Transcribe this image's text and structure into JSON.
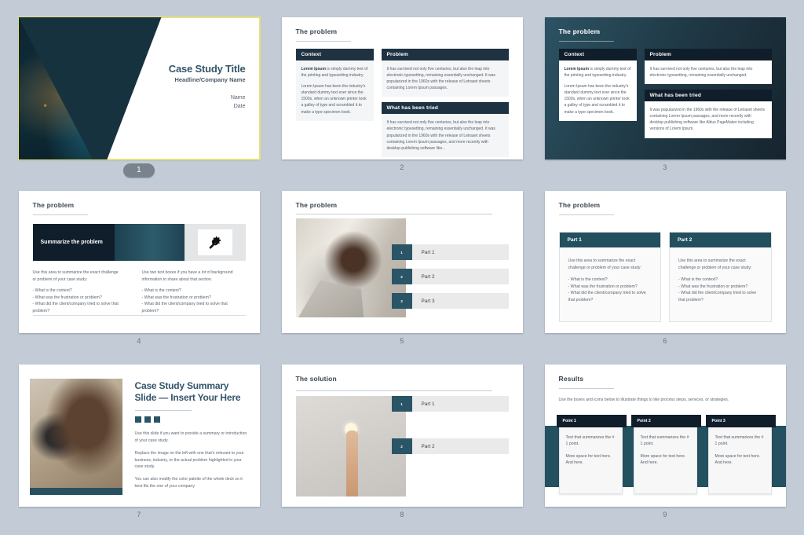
{
  "deck": {
    "slides": [
      {
        "number": "1",
        "selected": true,
        "title": "Case Study Title",
        "subtitle": "Headline/Company Name",
        "name_line": "Name",
        "date_line": "Date",
        "image_alt": "night-city-aerial-photo"
      },
      {
        "number": "2",
        "selected": false,
        "heading": "The problem",
        "context_header": "Context",
        "context_p1_bold": "Lorem Ipsum",
        "context_p1": " is simply dummy text of the printing and typesetting industry.",
        "context_p2": "Lorem Ipsum has been the industry's standard dummy text ever since the 1500s, when an unknown printer took a galley of type and scrambled it to make a type specimen book.",
        "problem_header": "Problem",
        "problem_body": "It has survived not only five centuries, but also the leap into electronic typesetting, remaining essentially unchanged. It was popularized in the 1960s with the release of Letraset sheets containing Lorem Ipsum passages.",
        "tried_header": "What has been tried",
        "tried_body": "It has survived not only five centuries, but also the leap into electronic typesetting, remaining essentially unchanged. It was popularized in the 1960s with the release of Letraset sheets containing Lorem Ipsum passages, and more recently with desktop publishing software like..."
      },
      {
        "number": "3",
        "selected": false,
        "heading": "The problem",
        "context_header": "Context",
        "context_p1_bold": "Lorem Ipsum",
        "context_p1": " is simply dummy text of the printing and typesetting industry.",
        "context_p2": "Lorem Ipsum has been the industry's standard dummy text ever since the 1500s, when an unknown printer took a galley of type and scrambled it to make a type specimen book.",
        "problem_header": "Problem",
        "problem_body": "It has survived not only five centuries, but also the leap into electronic typesetting, remaining essentially unchanged.",
        "tried_header": "What has been tried",
        "tried_body": "It was popularized in the 1960s with the release of Letraset sheets containing Lorem Ipsum passages, and more recently with desktop publishing software like Aldus PageMaker including versions of Lorem Ipsum."
      },
      {
        "number": "4",
        "selected": false,
        "heading": "The problem",
        "banner_text": "Summarize the problem",
        "icon": "gear-wrench-icon",
        "left_p1": "Use this area to summarize the exact challenge or problem of your case study:",
        "left_p2": "- What is the context?\n- What was the frustration or problem?\n- What did the client/company tried to solve that problem?",
        "right_p1": "Use two text boxes if you have a lot of background information to share about that section.",
        "right_p2": "- What is the context?\n- What was the frustration or problem?\n- What did the client/company tried to solve that problem?"
      },
      {
        "number": "5",
        "selected": false,
        "heading": "The problem",
        "image_alt": "frustrated-woman-at-laptop-photo",
        "parts": [
          {
            "num": "1",
            "label": "Part 1"
          },
          {
            "num": "2",
            "label": "Part 2"
          },
          {
            "num": "3",
            "label": "Part 3"
          }
        ]
      },
      {
        "number": "6",
        "selected": false,
        "heading": "The problem",
        "cards": [
          {
            "header": "Part 1",
            "p1": "Use this area to summarize the exact challenge or problem of your case study:",
            "p2": "- What is the context?\n- What was the frustration or problem?\n- What did the client/company tried to solve that problem?"
          },
          {
            "header": "Part 2",
            "p1": "Use this area to summarize the exact challenge or problem of your case study:",
            "p2": "- What is the context?\n- What was the frustration or problem?\n- What did the client/company tried to solve that problem?"
          }
        ]
      },
      {
        "number": "7",
        "selected": false,
        "image_alt": "woman-working-on-laptop-at-desk-photo",
        "title": "Case Study Summary Slide — Insert Your Here",
        "p1": "Use this slide if you want to provide a summary or introduction of your case study.",
        "p2": "Replace the image on the left with one that's relevant to your business, industry, or the actual problem highlighted in your case study.",
        "p3": "You can also modify the color palette of the whole deck so it best fits the one of your company"
      },
      {
        "number": "8",
        "selected": false,
        "heading": "The solution",
        "image_alt": "hand-holding-lightbulb-photo",
        "parts": [
          {
            "num": "1",
            "label": "Part 1"
          },
          {
            "num": "2",
            "label": "Part 2"
          }
        ]
      },
      {
        "number": "9",
        "selected": false,
        "heading": "Results",
        "subtitle": "Use the boxes and icons below to illustrate things to like process steps, services, or strategies.",
        "points": [
          {
            "header": "Point 1",
            "p1": "Text that summarizes the # 1 point.",
            "p2": "More space for text here. And here."
          },
          {
            "header": "Point 2",
            "p1": "Text that summarizes the # 1 point.",
            "p2": "More space for text here. And here."
          },
          {
            "header": "Point 3",
            "p1": "Text that summarizes the # 1 point.",
            "p2": "More space for text here. And here."
          }
        ]
      }
    ]
  },
  "colors": {
    "background": "#c3ccd6",
    "navy": "#101e2b",
    "teal": "#2a5566",
    "header_navy": "#1e3242",
    "accent_selection": "#e8e07a",
    "title_blue": "#33556b"
  }
}
